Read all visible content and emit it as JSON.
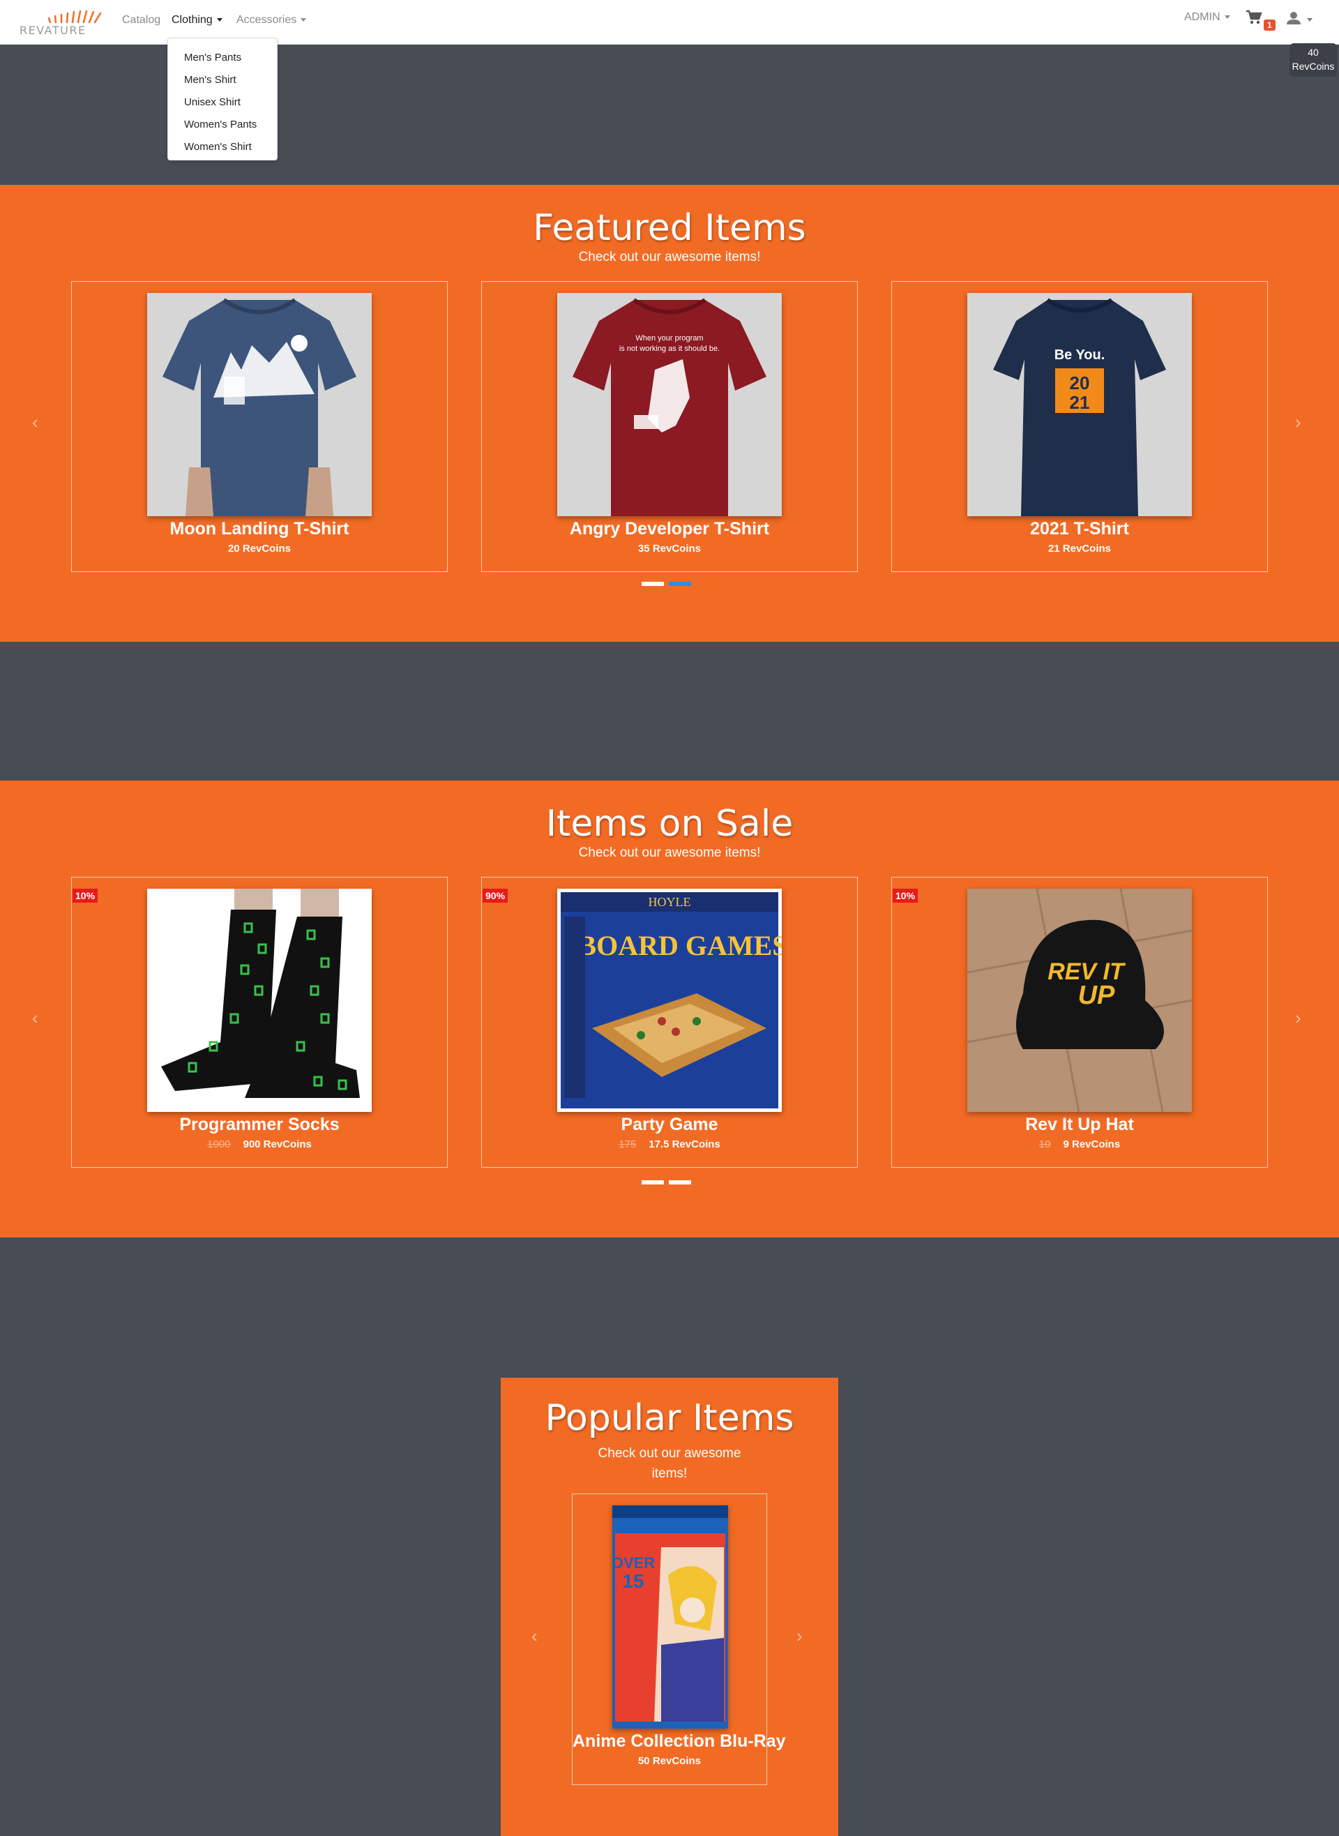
{
  "nav": {
    "logo_text": "REVATURE",
    "catalog": "Catalog",
    "clothing": "Clothing",
    "accessories": "Accessories",
    "admin": "ADMIN",
    "cart_count": "1",
    "coins_value": "40",
    "coins_unit": "RevCoins"
  },
  "clothing_menu": [
    "Men's Pants",
    "Men's Shirt",
    "Unisex Shirt",
    "Women's Pants",
    "Women's Shirt"
  ],
  "featured": {
    "title": "Featured Items",
    "subtitle": "Check out our awesome items!",
    "items": [
      {
        "name": "Moon Landing T-Shirt",
        "price": "20 RevCoins"
      },
      {
        "name": "Angry Developer T-Shirt",
        "price": "35 RevCoins"
      },
      {
        "name": "2021 T-Shirt",
        "price": "21 RevCoins"
      }
    ],
    "shirt_text_1": "When your program",
    "shirt_text_2": "is not working as it should be.",
    "shirt_text_3": "Be You.",
    "shirt_text_4": "20",
    "shirt_text_5": "21"
  },
  "sale": {
    "title": "Items on Sale",
    "subtitle": "Check out our awesome items!",
    "items": [
      {
        "badge": "10%",
        "name": "Programmer Socks",
        "old_price": "1000",
        "price": "900 RevCoins"
      },
      {
        "badge": "90%",
        "name": "Party Game",
        "old_price": "175",
        "price": "17.5 RevCoins"
      },
      {
        "badge": "10%",
        "name": "Rev It Up Hat",
        "old_price": "10",
        "price": "9 RevCoins"
      }
    ],
    "box_brand": "HOYLE",
    "box_title": "BOARD GAMES",
    "hat_text_1": "REV IT",
    "hat_text_2": "UP"
  },
  "popular": {
    "title": "Popular Items",
    "subtitle": "Check out our awesome items!",
    "item": {
      "name": "Anime Collection Blu-Ray",
      "price": "50 RevCoins"
    },
    "cover_text_1": "OVER",
    "cover_text_2": "15"
  },
  "colors": {
    "brand_orange": "#f26b25",
    "dark_bg": "#484c55",
    "indicator_active": "#2b8de8",
    "sale_badge": "#e81a1a"
  }
}
